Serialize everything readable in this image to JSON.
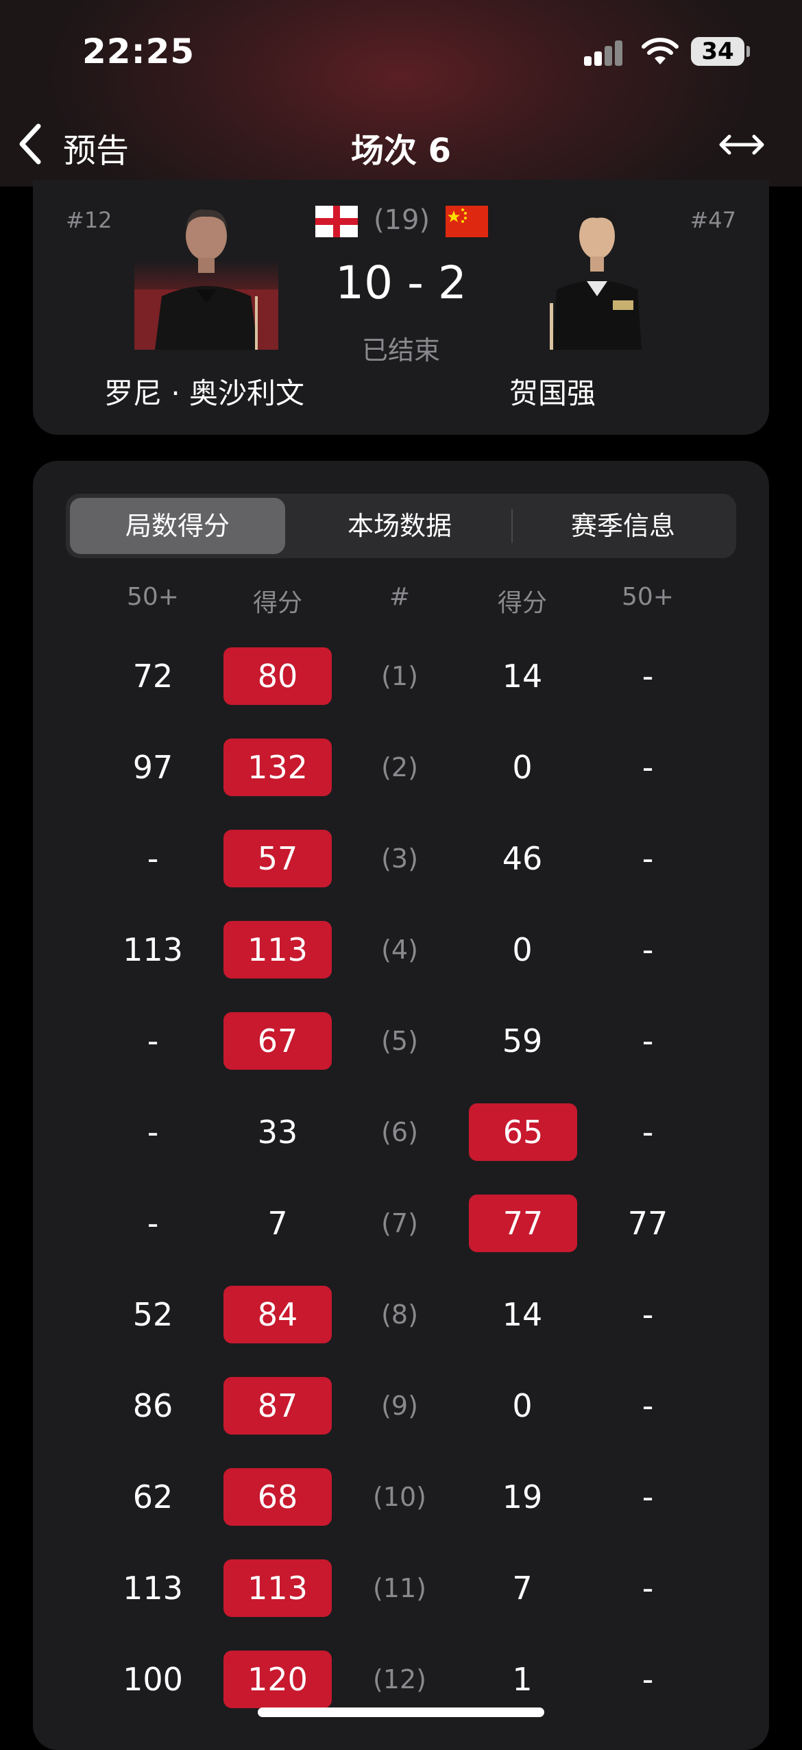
{
  "status_bar": {
    "time": "22:25",
    "battery": "34"
  },
  "nav": {
    "back_label": "预告",
    "title": "场次 6"
  },
  "match": {
    "left_rank": "#12",
    "right_rank": "#47",
    "best_of": "(19)",
    "score": "10 - 2",
    "status": "已结束",
    "left_player": "罗尼 · 奥沙利文",
    "right_player": "贺国强"
  },
  "tabs": [
    "局数得分",
    "本场数据",
    "赛季信息"
  ],
  "columns": [
    "50+",
    "得分",
    "#",
    "得分",
    "50+"
  ],
  "frames": [
    {
      "l50": "72",
      "ls": "80",
      "n": "(1)",
      "rs": "14",
      "r50": "-",
      "winner": "left"
    },
    {
      "l50": "97",
      "ls": "132",
      "n": "(2)",
      "rs": "0",
      "r50": "-",
      "winner": "left"
    },
    {
      "l50": "-",
      "ls": "57",
      "n": "(3)",
      "rs": "46",
      "r50": "-",
      "winner": "left"
    },
    {
      "l50": "113",
      "ls": "113",
      "n": "(4)",
      "rs": "0",
      "r50": "-",
      "winner": "left"
    },
    {
      "l50": "-",
      "ls": "67",
      "n": "(5)",
      "rs": "59",
      "r50": "-",
      "winner": "left"
    },
    {
      "l50": "-",
      "ls": "33",
      "n": "(6)",
      "rs": "65",
      "r50": "-",
      "winner": "right"
    },
    {
      "l50": "-",
      "ls": "7",
      "n": "(7)",
      "rs": "77",
      "r50": "77",
      "winner": "right"
    },
    {
      "l50": "52",
      "ls": "84",
      "n": "(8)",
      "rs": "14",
      "r50": "-",
      "winner": "left"
    },
    {
      "l50": "86",
      "ls": "87",
      "n": "(9)",
      "rs": "0",
      "r50": "-",
      "winner": "left"
    },
    {
      "l50": "62",
      "ls": "68",
      "n": "(10)",
      "rs": "19",
      "r50": "-",
      "winner": "left"
    },
    {
      "l50": "113",
      "ls": "113",
      "n": "(11)",
      "rs": "7",
      "r50": "-",
      "winner": "left"
    },
    {
      "l50": "100",
      "ls": "120",
      "n": "(12)",
      "rs": "1",
      "r50": "-",
      "winner": "left"
    }
  ],
  "colors": {
    "win": "#c8192e",
    "card": "#1c1c1e",
    "muted": "#8a8a8e"
  },
  "icons": {
    "back": "chevron-left-icon",
    "swap": "swap-arrows-icon",
    "signal": "signal-icon",
    "wifi": "wifi-icon",
    "battery": "battery-icon",
    "flag_left": "england-flag-icon",
    "flag_right": "china-flag-icon"
  }
}
